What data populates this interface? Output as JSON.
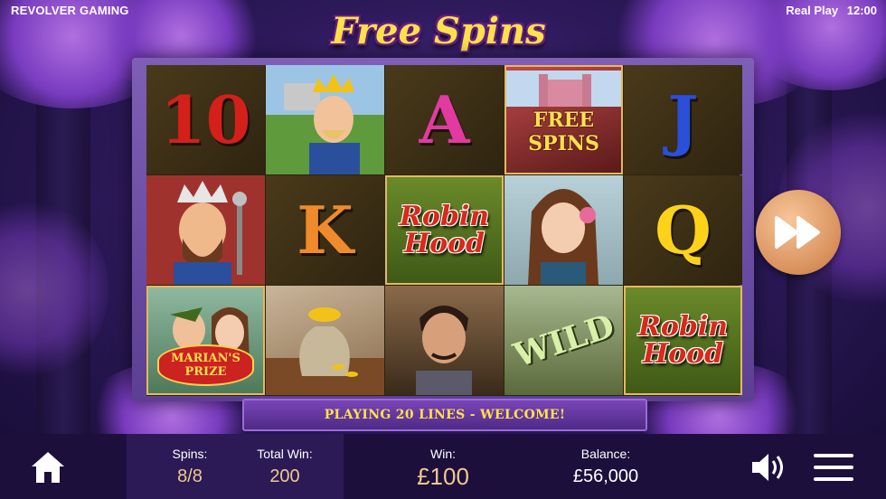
{
  "header": {
    "brand": "REVOLVER GAMING",
    "mode": "Real Play",
    "clock": "12:00",
    "title": "Free Spins"
  },
  "reels": {
    "row1": [
      "10",
      "king-arthur",
      "A",
      "FREE SPINS",
      "J"
    ],
    "row2": [
      "prince-john",
      "K",
      "Robin Hood",
      "maid-marian",
      "Q"
    ],
    "row3": [
      "MARIAN'S PRIZE",
      "gold-bag",
      "sheriff",
      "WILD",
      "Robin Hood"
    ],
    "labels": {
      "ten": "10",
      "ace": "A",
      "jack": "J",
      "king": "K",
      "queen": "Q",
      "free_spins_top": "FREE",
      "free_spins_bottom": "SPINS",
      "robin_top": "Robin",
      "robin_bottom": "Hood",
      "wild": "WILD",
      "prize_top": "MARIAN'S",
      "prize_bottom": "PRIZE"
    },
    "colors": {
      "ten": "#d3201a",
      "ace": "#e23aa0",
      "jack": "#2a4fd8",
      "king": "#f08a2a",
      "queen": "#ffd21a"
    }
  },
  "banner": {
    "message": "PLAYING 20 LINES - WELCOME!"
  },
  "controls": {
    "fast_forward_icon": "fast-forward-icon",
    "home_icon": "home-icon",
    "sound_icon": "speaker-icon",
    "menu_icon": "hamburger-menu-icon"
  },
  "stats": {
    "spins_label": "Spins:",
    "spins_value": "8/8",
    "total_win_label": "Total Win:",
    "total_win_value": "200",
    "win_label": "Win:",
    "win_value": "£100",
    "balance_label": "Balance:",
    "balance_value": "£56,000"
  }
}
